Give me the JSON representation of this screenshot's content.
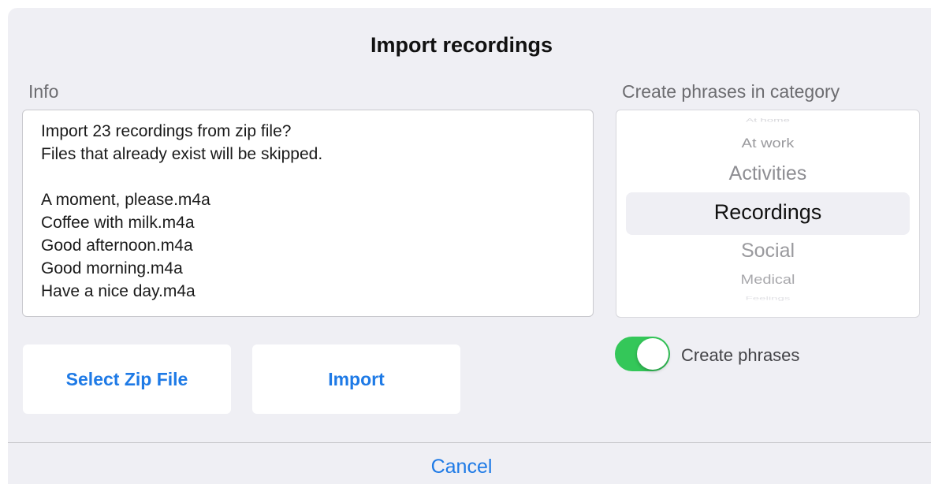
{
  "dialog": {
    "title": "Import recordings",
    "cancel_label": "Cancel"
  },
  "info": {
    "label": "Info",
    "text": "Import 23 recordings from zip file?\nFiles that already exist will be skipped.\n\nA moment, please.m4a\nCoffee with milk.m4a\nGood afternoon.m4a\nGood morning.m4a\nHave a nice day.m4a"
  },
  "category": {
    "label": "Create phrases in category",
    "items": [
      "At home",
      "At work",
      "Activities",
      "Recordings",
      "Social",
      "Medical",
      "Feelings"
    ],
    "selected": "Recordings"
  },
  "buttons": {
    "select_zip": "Select Zip File",
    "import": "Import"
  },
  "create_phrases": {
    "label": "Create phrases",
    "enabled": true,
    "on_color": "#34c759"
  },
  "colors": {
    "accent": "#1e7ae6",
    "background": "#efeff4"
  }
}
